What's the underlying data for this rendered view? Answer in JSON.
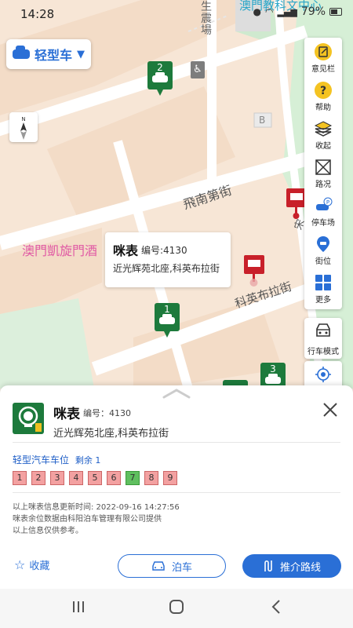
{
  "status": {
    "time": "14:28",
    "battery": "79%"
  },
  "map": {
    "labels": {
      "top_center": "澳門教科文中心",
      "street_v": "生\n震\n場",
      "street_fei": "飛南第街",
      "street_ke": "科英布拉街",
      "hotel": "澳門凱旋門酒",
      "bus_vert": "宋",
      "b_marker": "B"
    },
    "markers": {
      "m1": "1",
      "m2": "2",
      "m3": "3"
    }
  },
  "vehicle_select": {
    "label": "轻型车",
    "icon": "car-icon"
  },
  "right_panel": [
    {
      "label": "意见栏",
      "icon": "feedback-icon"
    },
    {
      "label": "帮助",
      "icon": "help-icon"
    },
    {
      "label": "收起",
      "icon": "layers-icon"
    },
    {
      "label": "路况",
      "icon": "traffic-icon"
    },
    {
      "label": "停车场",
      "icon": "parking-icon"
    },
    {
      "label": "街位",
      "icon": "street-spot-icon"
    },
    {
      "label": "更多",
      "icon": "more-icon"
    }
  ],
  "drive_mode": {
    "label": "行车模式"
  },
  "popup": {
    "title": "咪表",
    "number": "编号:4130",
    "address": "近光辉苑北座,科英布拉街"
  },
  "sheet": {
    "title": "咪表",
    "number_label": "编号：4130",
    "address": "近光辉苑北座,科英布拉街",
    "spot_heading": "轻型汽车车位",
    "remaining": "剩余 1",
    "spots": [
      {
        "no": "1",
        "state": "occupied"
      },
      {
        "no": "2",
        "state": "occupied"
      },
      {
        "no": "3",
        "state": "occupied"
      },
      {
        "no": "4",
        "state": "occupied"
      },
      {
        "no": "5",
        "state": "occupied"
      },
      {
        "no": "6",
        "state": "occupied"
      },
      {
        "no": "7",
        "state": "free"
      },
      {
        "no": "8",
        "state": "occupied"
      },
      {
        "no": "9",
        "state": "occupied"
      }
    ],
    "info_line1": "以上咪表信息更新时间:     2022-09-16 14:27:56",
    "info_line2": "咪表余位数据由科阳泊车管理有限公司提供",
    "info_line3": "以上信息仅供参考。",
    "fav_label": "收藏",
    "park_label": "泊车",
    "route_label": "推介路线"
  },
  "colors": {
    "accent": "#2a6fd6",
    "green": "#1d7a3c",
    "occupied": "#f3a1a1",
    "free": "#5fbf5f"
  }
}
